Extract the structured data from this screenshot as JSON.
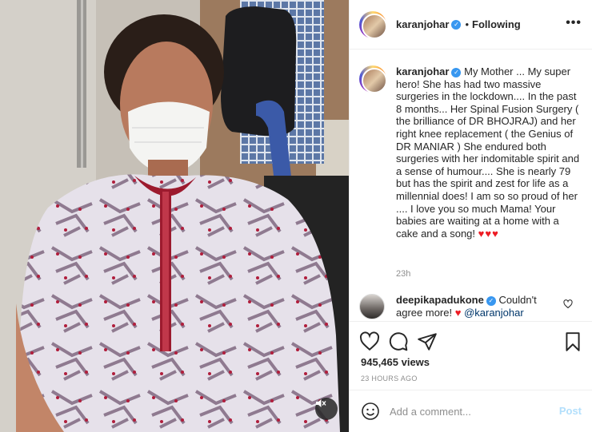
{
  "post": {
    "username": "karanjohar",
    "verified_glyph": "✓",
    "follow_sep": "•",
    "follow_status": "Following",
    "more_label": "•••",
    "caption_username": "karanjohar",
    "caption_text": "My Mother ... My super hero! She has had two massive surgeries in the lockdown.... In the past 8 months... Her Spinal Fusion Surgery ( the brilliance of DR BHOJRAJ) and her right knee replacement ( the Genius of DR MANIAR ) She endured both surgeries with her indomitable spirit and a sense of humour.... She is nearly 79 but has the spirit and zest for life as a millennial does! I am so so proud of her .... I love you so much Mama! Your babies are waiting at a home with a cake and a song!",
    "caption_hearts": "♥♥♥",
    "caption_time": "23h"
  },
  "reply": {
    "username": "deepikapadukone",
    "text": "Couldn't agree more!",
    "heart": "♥",
    "mention": "@karanjohar"
  },
  "stats": {
    "views": "945,465 views",
    "posted": "23 HOURS AGO"
  },
  "comment_box": {
    "placeholder": "Add a comment...",
    "post_label": "Post"
  },
  "colors": {
    "verified": "#3897f0",
    "heart": "#ed1c24",
    "post_disabled": "#b2dffc",
    "muted_text": "#8e8e8e"
  },
  "icons": [
    "mute-icon",
    "more-icon",
    "heart-icon",
    "comment-icon",
    "share-icon",
    "bookmark-icon",
    "emoji-icon"
  ]
}
